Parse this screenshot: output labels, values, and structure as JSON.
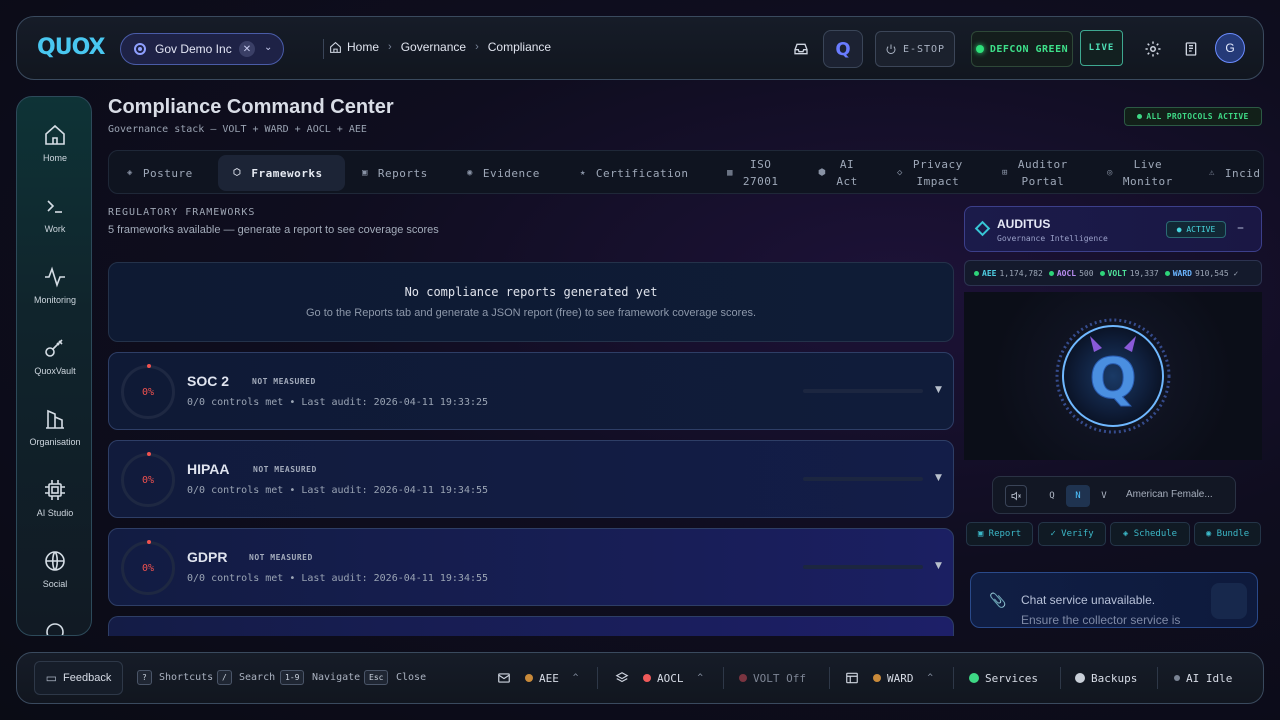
{
  "topbar": {
    "logo": "QUOX",
    "org_name": "Gov Demo Inc",
    "breadcrumb": [
      "Home",
      "Governance",
      "Compliance"
    ],
    "estop_label": "E-STOP",
    "defcon_label": "DEFCON GREEN",
    "live_label": "LIVE",
    "avatar_initial": "G"
  },
  "sidebar": {
    "items": [
      {
        "label": "Home",
        "icon": "home-icon"
      },
      {
        "label": "Work",
        "icon": "terminal-icon"
      },
      {
        "label": "Monitoring",
        "icon": "pulse-icon"
      },
      {
        "label": "QuoxVault",
        "icon": "key-icon"
      },
      {
        "label": "Organisation",
        "icon": "building-icon"
      },
      {
        "label": "AI Studio",
        "icon": "chip-icon"
      },
      {
        "label": "Social",
        "icon": "globe-icon"
      }
    ]
  },
  "page": {
    "title": "Compliance Command Center",
    "subtitle": "Governance stack — VOLT + WARD + AOCL + AEE",
    "protocols_badge": "ALL PROTOCOLS ACTIVE"
  },
  "tabs": [
    {
      "icon": "◈",
      "label": "Posture"
    },
    {
      "icon": "⬡",
      "label": "Frameworks",
      "active": true
    },
    {
      "icon": "▣",
      "label": "Reports"
    },
    {
      "icon": "◉",
      "label": "Evidence"
    },
    {
      "icon": "★",
      "label": "Certification"
    },
    {
      "icon": "▦",
      "label_1": "ISO",
      "label_2": "27001"
    },
    {
      "icon": "⬢",
      "label_1": "AI",
      "label_2": "Act"
    },
    {
      "icon": "◇",
      "label_1": "Privacy",
      "label_2": "Impact"
    },
    {
      "icon": "⊞",
      "label_1": "Auditor",
      "label_2": "Portal"
    },
    {
      "icon": "◎",
      "label_1": "Live",
      "label_2": "Monitor"
    },
    {
      "icon": "⚠",
      "label": "Incid"
    }
  ],
  "frameworks_section": {
    "label": "REGULATORY FRAMEWORKS",
    "sub": "5 frameworks available — generate a report to see coverage scores",
    "empty_title": "No compliance reports generated yet",
    "empty_text": "Go to the Reports tab and generate a JSON report (free) to see framework coverage scores.",
    "items": [
      {
        "name": "SOC 2",
        "score": "0%",
        "status": "NOT MEASURED",
        "meta": "0/0 controls met • Last audit: 2026-04-11 19:33:25"
      },
      {
        "name": "HIPAA",
        "score": "0%",
        "status": "NOT MEASURED",
        "meta": "0/0 controls met • Last audit: 2026-04-11 19:34:55"
      },
      {
        "name": "GDPR",
        "score": "0%",
        "status": "NOT MEASURED",
        "meta": "0/0 controls met • Last audit: 2026-04-11 19:34:55"
      }
    ]
  },
  "auditus": {
    "title": "AUDITUS",
    "subtitle": "Governance Intelligence",
    "status": "● ACTIVE",
    "metrics": [
      {
        "key": "AEE",
        "value": "1,174,782",
        "color": "#2ed47a"
      },
      {
        "key": "AOCL",
        "value": "500",
        "color": "#2ed47a"
      },
      {
        "key": "VOLT",
        "value": "19,337",
        "color": "#2ed47a"
      },
      {
        "key": "WARD",
        "value": "910,545 ✓",
        "color": "#2ed47a"
      }
    ],
    "voice_options": [
      "Q",
      "N",
      "V"
    ],
    "voice_selected": "N",
    "voice_name": "American Female...",
    "quick_actions": [
      "▣ Report",
      "✓ Verify",
      "◈ Schedule",
      "◉ Bundle"
    ],
    "chat_message": "Chat service unavailable.",
    "chat_message_2": "Ensure the collector service is"
  },
  "bottombar": {
    "feedback_label": "Feedback",
    "shortcuts": [
      {
        "key": "?",
        "label": "Shortcuts"
      },
      {
        "key": "/",
        "label": "Search"
      },
      {
        "key": "1-9",
        "label": "Navigate"
      },
      {
        "key": "Esc",
        "label": "Close"
      }
    ],
    "statuses": [
      {
        "label": "AEE",
        "color": "#c98a3a"
      },
      {
        "label": "AOCL",
        "color": "#ef5a5a"
      },
      {
        "label": "VOLT Off",
        "color": "#7a3440"
      },
      {
        "label": "WARD",
        "color": "#c98a3a"
      },
      {
        "label": "Services",
        "color": "#3ed885"
      },
      {
        "label": "Backups",
        "color": "#c9cfd8"
      },
      {
        "label": "AI Idle",
        "color": "#7a8494"
      }
    ]
  }
}
